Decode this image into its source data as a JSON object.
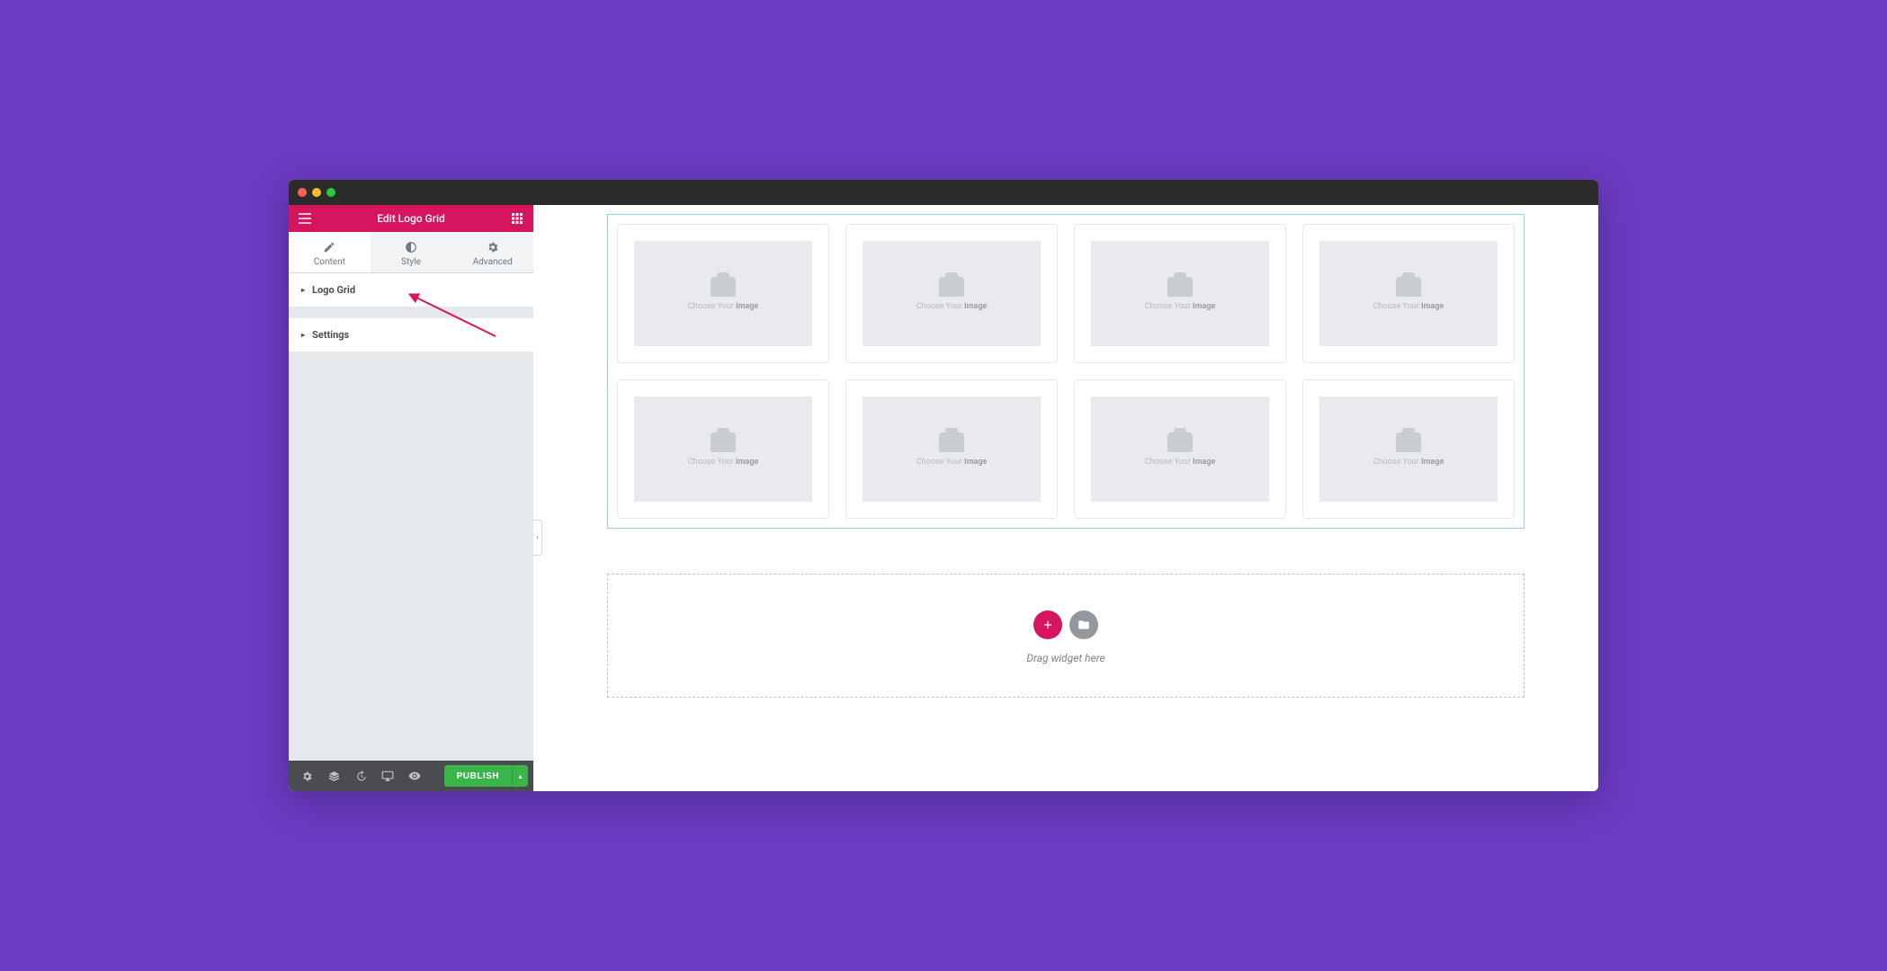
{
  "panel": {
    "title": "Edit Logo Grid",
    "tabs": {
      "content": "Content",
      "style": "Style",
      "advanced": "Advanced"
    },
    "sections": {
      "logo_grid": "Logo Grid",
      "settings": "Settings"
    }
  },
  "footer": {
    "publish": "PUBLISH"
  },
  "canvas": {
    "placeholder_prefix": "Choose Your ",
    "placeholder_strong": "Image",
    "dropzone_text": "Drag widget here"
  }
}
